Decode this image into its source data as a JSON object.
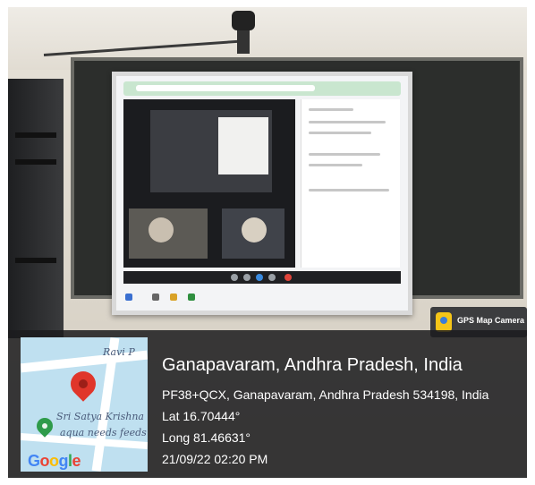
{
  "badge": {
    "label": "GPS Map Camera",
    "icon": "map-pin-app-icon"
  },
  "location": {
    "title": "Ganapavaram, Andhra Pradesh, India",
    "address": "PF38+QCX, Ganapavaram, Andhra Pradesh 534198, India",
    "lat": "Lat 16.70444°",
    "long": "Long 81.46631°",
    "datetime": "21/09/22 02:20 PM"
  },
  "map": {
    "label_top": "Ravi P",
    "label_mid1": "Sri Satya Krishna",
    "label_mid2": "aqua needs feeds",
    "provider_letters": [
      "G",
      "o",
      "o",
      "g",
      "l",
      "e"
    ],
    "provider_colors": [
      "#4285F4",
      "#EA4335",
      "#FBBC05",
      "#4285F4",
      "#34A853",
      "#EA4335"
    ]
  },
  "colors": {
    "overlay": "#1c1c1e",
    "pin_red": "#e0362b",
    "pin_green": "#2e9b4a"
  }
}
